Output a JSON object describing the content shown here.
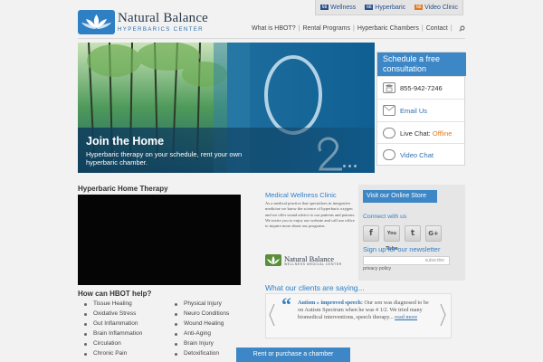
{
  "top_tabs": [
    {
      "label": "Wellness",
      "icon": "wellness-tab-icon"
    },
    {
      "label": "Hyperbaric",
      "icon": "hyperbaric-tab-icon"
    },
    {
      "label": "Video Clinic",
      "icon": "video-clinic-tab-icon"
    }
  ],
  "brand": {
    "name": "Natural Balance",
    "sub": "HYPERBARICS CENTER",
    "color": "#2f7fc4"
  },
  "nav": {
    "items": [
      "What is HBOT?",
      "Rental Programs",
      "Hyperbaric Chambers",
      "Contact"
    ],
    "search_icon": "search-icon"
  },
  "hero": {
    "title": "Join the Home",
    "text": "Hyperbaric therapy on your schedule, rent your own hyperbaric chamber."
  },
  "schedule_panel": {
    "title": "Schedule a free consultation",
    "phone": "855-942-7246",
    "email": "Email Us",
    "live_chat_label": "Live Chat:",
    "live_chat_status": "Offline",
    "video_chat": "Video Chat"
  },
  "left": {
    "home_therapy_title": "Hyperbaric Home Therapy",
    "help_title": "How can HBOT help?",
    "help_items": [
      "Tissue Healing",
      "Physical Injury",
      "Oxidative Stress",
      "Neuro Conditions",
      "Gut Inflammation",
      "Wound Healing",
      "Brain Inflammation",
      "Anti-Aging",
      "Circulation",
      "Brain Injury",
      "Chronic Pain",
      "Detoxification"
    ]
  },
  "middle": {
    "title": "Medical Wellness Clinic",
    "text": "As a medical practice that specializes in integrative medicine we know the science of hyperbaric oxygen and we offer sound advice to our patients and patrons. We invite you to enjoy our website and call our office to inquire more about our programs.",
    "logo_name": "Natural Balance",
    "logo_sub": "WELLNESS MEDICAL CENTER"
  },
  "right": {
    "store_button": "Visit our Online Store",
    "connect": "Connect with us",
    "socials": [
      {
        "label": "f",
        "name": "facebook-icon"
      },
      {
        "label": "You Tube",
        "name": "youtube-icon"
      },
      {
        "label": "t",
        "name": "twitter-icon"
      },
      {
        "label": "G+",
        "name": "google-plus-icon"
      }
    ],
    "newsletter": "Sign up for our newsletter",
    "subscribe_placeholder": "subscribe",
    "privacy": "privacy policy"
  },
  "testimonials": {
    "title": "What our clients are saying...",
    "headline": "Autism » improved speech:",
    "text": "Our son was diagnosed to be on Autism Spectrum when he was 4 1/2. We tried many biomedical interventions, speech therapy...",
    "read_more": "read more"
  },
  "cta": "Rent or purchase a chamber"
}
